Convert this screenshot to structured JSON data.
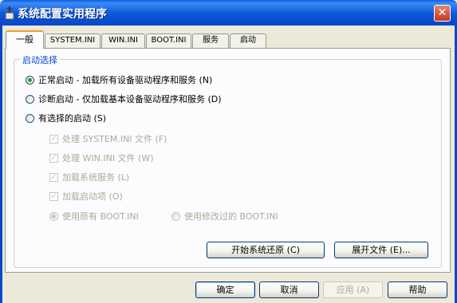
{
  "window": {
    "title": "系统配置实用程序",
    "close_glyph": "✕"
  },
  "tabs": [
    {
      "label": "一般",
      "active": true
    },
    {
      "label": "SYSTEM.INI",
      "active": false
    },
    {
      "label": "WIN.INI",
      "active": false
    },
    {
      "label": "BOOT.INI",
      "active": false
    },
    {
      "label": "服务",
      "active": false
    },
    {
      "label": "启动",
      "active": false
    }
  ],
  "startup_group": {
    "legend": "启动选择",
    "options": [
      {
        "label": "正常启动 - 加载所有设备驱动程序和服务 (N)",
        "selected": true
      },
      {
        "label": "诊断启动 - 仅加载基本设备驱动程序和服务 (D)",
        "selected": false
      },
      {
        "label": "有选择的启动 (S)",
        "selected": false
      }
    ],
    "selective": {
      "checkboxes": [
        {
          "label": "处理 SYSTEM.INI 文件 (F)",
          "checked": true,
          "enabled": false
        },
        {
          "label": "处理 WIN.INI 文件 (W)",
          "checked": true,
          "enabled": false
        },
        {
          "label": "加载系统服务 (L)",
          "checked": true,
          "enabled": false
        },
        {
          "label": "加载启动项 (O)",
          "checked": true,
          "enabled": false
        }
      ],
      "boot_original": {
        "label": "使用原有 BOOT.INI",
        "selected": true,
        "enabled": false
      },
      "boot_modified": {
        "label": "使用修改过的 BOOT.INI",
        "selected": false,
        "enabled": false
      }
    },
    "buttons": {
      "restore": "开始系统还原 (C)",
      "expand": "展开文件 (E)..."
    }
  },
  "dialog_buttons": {
    "ok": "确定",
    "cancel": "取消",
    "apply": "应用 (A)",
    "help": "帮助"
  },
  "colors": {
    "titlebar": "#0a5fe0",
    "legend": "#0046d5",
    "radio_dot": "#21a121",
    "disabled_text": "#aca899"
  }
}
